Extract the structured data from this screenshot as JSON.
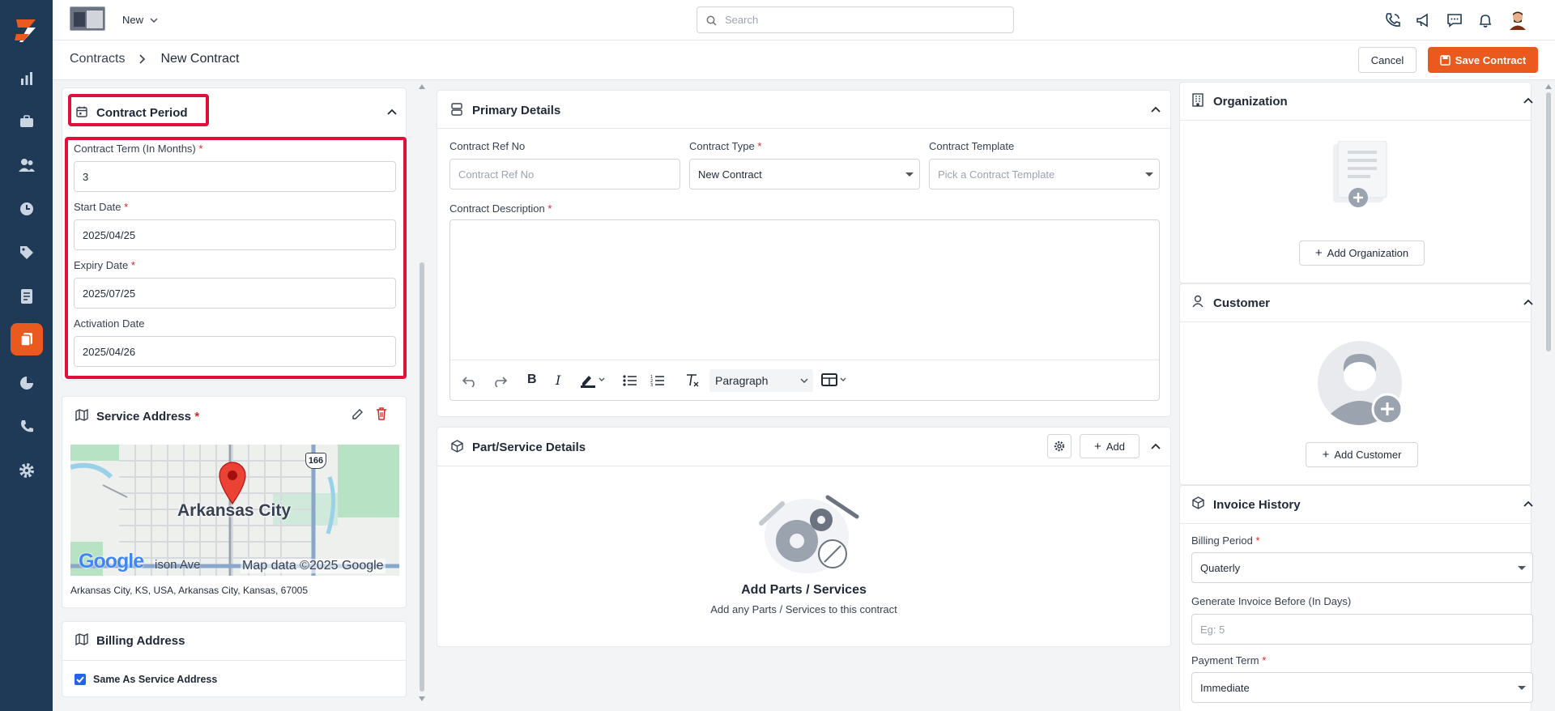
{
  "topbar": {
    "new_label": "New",
    "search_placeholder": "Search"
  },
  "breadcrumb": {
    "root": "Contracts",
    "current": "New Contract"
  },
  "actions": {
    "cancel": "Cancel",
    "save": "Save Contract"
  },
  "contract_period": {
    "title": "Contract Period",
    "term_label": "Contract Term (In Months)",
    "term_value": "3",
    "start_label": "Start Date",
    "start_value": "2025/04/25",
    "expiry_label": "Expiry Date",
    "expiry_value": "2025/07/25",
    "activation_label": "Activation Date",
    "activation_value": "2025/04/26"
  },
  "service_address": {
    "title": "Service Address",
    "map_city": "Arkansas City",
    "map_highway": "166",
    "map_street": "ison Ave",
    "map_credit": "Map data ©2025 Google",
    "map_brand": "Google",
    "address": "Arkansas City, KS, USA, Arkansas City, Kansas, 67005"
  },
  "billing_address": {
    "title": "Billing Address",
    "same_label": "Same As Service Address",
    "same_checked": true
  },
  "primary_details": {
    "title": "Primary Details",
    "ref_label": "Contract Ref No",
    "ref_placeholder": "Contract Ref No",
    "type_label": "Contract Type",
    "type_value": "New Contract",
    "template_label": "Contract Template",
    "template_placeholder": "Pick a Contract Template",
    "desc_label": "Contract Description",
    "paragraph": "Paragraph"
  },
  "parts": {
    "title": "Part/Service Details",
    "add_label": "Add",
    "empty_title": "Add Parts / Services",
    "empty_text": "Add any Parts / Services to this contract"
  },
  "organization": {
    "title": "Organization",
    "add_label": "Add Organization"
  },
  "customer": {
    "title": "Customer",
    "add_label": "Add Customer"
  },
  "invoice": {
    "title": "Invoice History",
    "billing_label": "Billing Period",
    "billing_value": "Quaterly",
    "generate_label": "Generate Invoice Before (In Days)",
    "generate_placeholder": "Eg: 5",
    "payment_label": "Payment Term",
    "payment_value": "Immediate"
  },
  "colors": {
    "sidebar": "#1e3a56",
    "accent": "#ea5a1f",
    "highlight": "#e0103c",
    "required": "#dc2626"
  },
  "icons": [
    "logo-icon",
    "analytics-icon",
    "briefcase-icon",
    "users-icon",
    "clock-icon",
    "tag-icon",
    "invoice-icon",
    "contracts-icon",
    "pie-chart-icon",
    "phone-icon",
    "settings-icon",
    "search-icon",
    "call-icon",
    "megaphone-icon",
    "chat-icon",
    "bell-icon",
    "calendar-icon",
    "map-icon",
    "edit-icon",
    "trash-icon",
    "list-icon",
    "box-icon",
    "gear-icon",
    "building-icon",
    "user-icon"
  ]
}
